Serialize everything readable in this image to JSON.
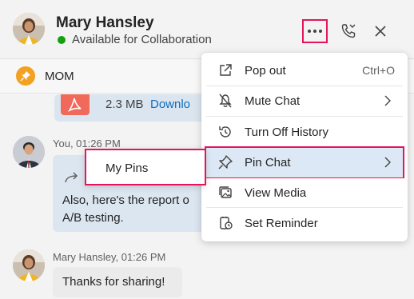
{
  "header": {
    "contact_name": "Mary Hansley",
    "status": "Available for Collaboration",
    "status_color": "#13a10e"
  },
  "pinned": {
    "label": "MOM",
    "badge_color": "#f2a120"
  },
  "messages": [
    {
      "type": "file",
      "file_size": "2.3 MB",
      "action": "Downlo"
    },
    {
      "sender": "You",
      "time": "01:26 PM",
      "meta": "You, 01:26 PM",
      "text_line1": "Also, here's the report o",
      "text_line2": "A/B testing."
    },
    {
      "sender": "Mary Hansley",
      "time": "01:26 PM",
      "meta": "Mary Hansley, 01:26 PM",
      "text": "Thanks for sharing!"
    }
  ],
  "context_menu": {
    "items": [
      {
        "label": "Pop out",
        "shortcut": "Ctrl+O",
        "icon": "pop-out-icon"
      },
      {
        "label": "Mute Chat",
        "icon": "mute-icon",
        "has_submenu": true
      },
      {
        "label": "Turn Off History",
        "icon": "history-icon"
      },
      {
        "label": "Pin Chat",
        "icon": "pin-icon",
        "has_submenu": true,
        "highlighted": true
      },
      {
        "label": "View Media",
        "icon": "media-icon"
      },
      {
        "label": "Set Reminder",
        "icon": "reminder-icon"
      }
    ]
  },
  "submenu": {
    "items": [
      {
        "label": "My Pins"
      }
    ]
  },
  "colors": {
    "accent_highlight": "#e6145a",
    "link": "#0f6cbd",
    "menu_hover": "#dce8f5"
  }
}
